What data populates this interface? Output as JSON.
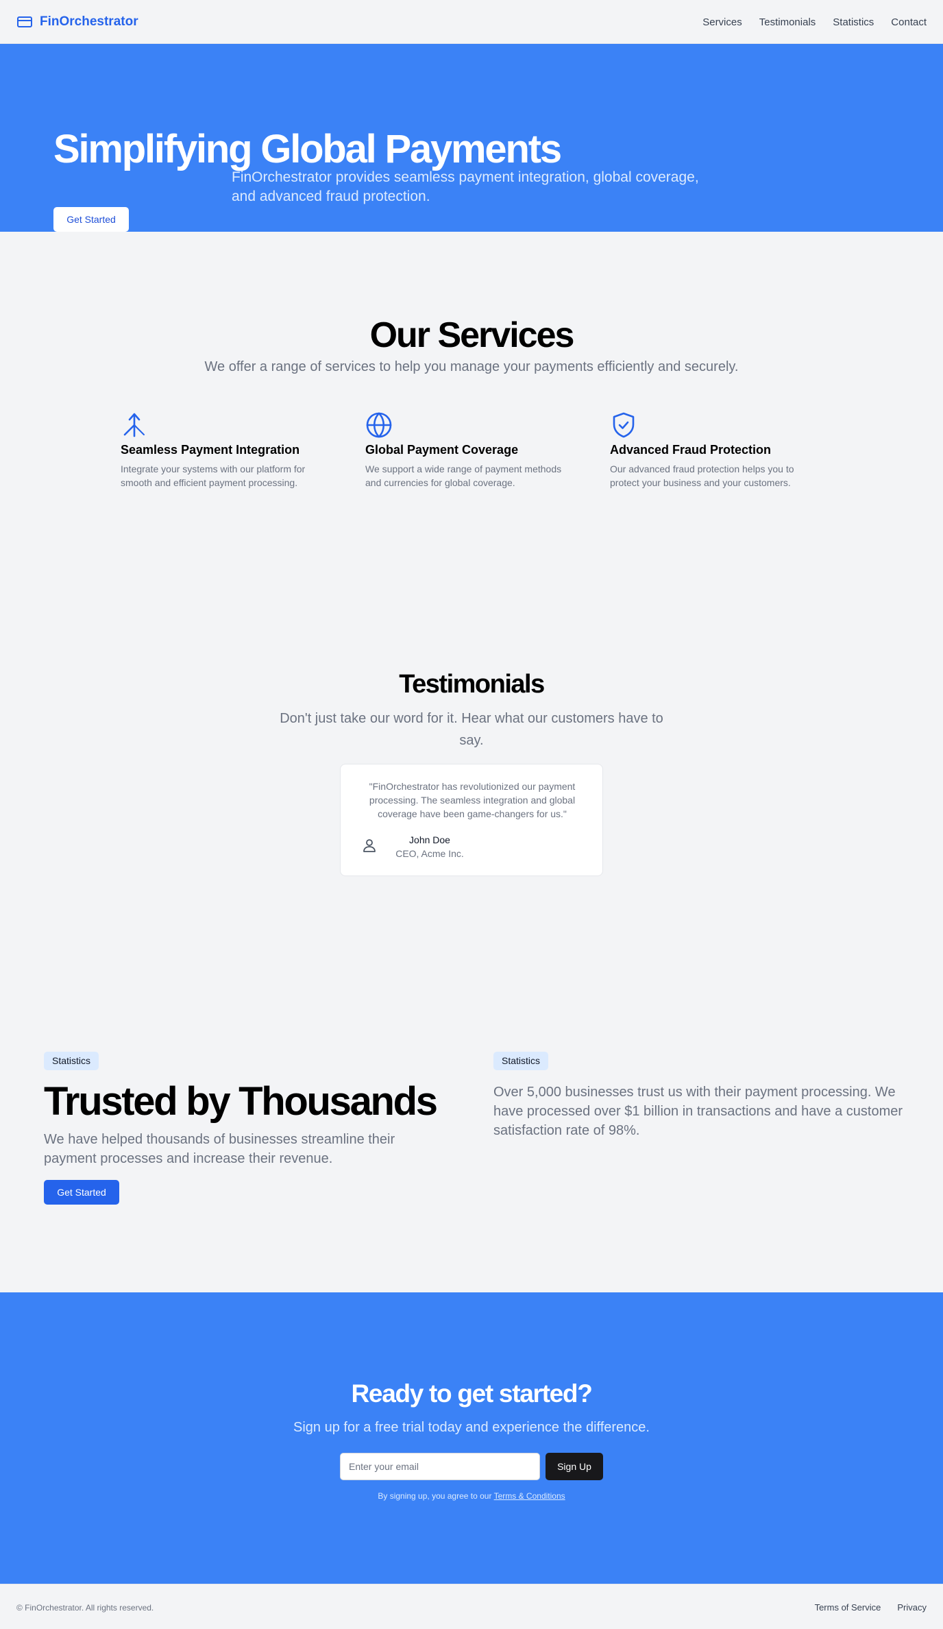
{
  "header": {
    "brand": "FinOrchestrator",
    "brand_icon": "credit-card-icon",
    "nav": [
      "Services",
      "Testimonials",
      "Statistics",
      "Contact"
    ]
  },
  "hero": {
    "title": "Simplifying Global Payments",
    "subtitle": "FinOrchestrator provides seamless payment integration, global coverage, and advanced fraud protection.",
    "cta": "Get Started"
  },
  "services": {
    "title": "Our Services",
    "subtitle": "We offer a range of services to help you manage your payments efficiently and securely.",
    "items": [
      {
        "icon": "merge-icon",
        "title": "Seamless Payment Integration",
        "description": "Integrate your systems with our platform for smooth and efficient payment processing."
      },
      {
        "icon": "globe-icon",
        "title": "Global Payment Coverage",
        "description": "We support a wide range of payment methods and currencies for global coverage."
      },
      {
        "icon": "shield-check-icon",
        "title": "Advanced Fraud Protection",
        "description": "Our advanced fraud protection helps you to protect your business and your customers."
      }
    ]
  },
  "testimonials": {
    "title": "Testimonials",
    "subtitle": "Don't just take our word for it. Hear what our customers have to say.",
    "quote": "\"FinOrchestrator has revolutionized our payment processing. The seamless integration and global coverage have been game-changers for us.\"",
    "name": "John Doe",
    "role": "CEO, Acme Inc.",
    "avatar_icon": "user-icon"
  },
  "statistics": {
    "badge": "Statistics",
    "title": "Trusted by Thousands",
    "subtitle": "We have helped thousands of businesses streamline their payment processes and increase their revenue.",
    "cta": "Get Started",
    "right_badge": "Statistics",
    "right_text": "Over 5,000 businesses trust us with their payment processing. We have processed over $1 billion in transactions and have a customer satisfaction rate of 98%."
  },
  "cta_section": {
    "title": "Ready to get started?",
    "subtitle": "Sign up for a free trial today and experience the difference.",
    "email_placeholder": "Enter your email",
    "button": "Sign Up",
    "legal_prefix": "By signing up, you agree to our ",
    "legal_link": "Terms & Conditions"
  },
  "footer": {
    "copyright": "© FinOrchestrator. All rights reserved.",
    "links": [
      "Terms of Service",
      "Privacy"
    ]
  },
  "colors": {
    "primary": "#3b82f6",
    "accent": "#2563eb",
    "background": "#f3f4f6"
  }
}
